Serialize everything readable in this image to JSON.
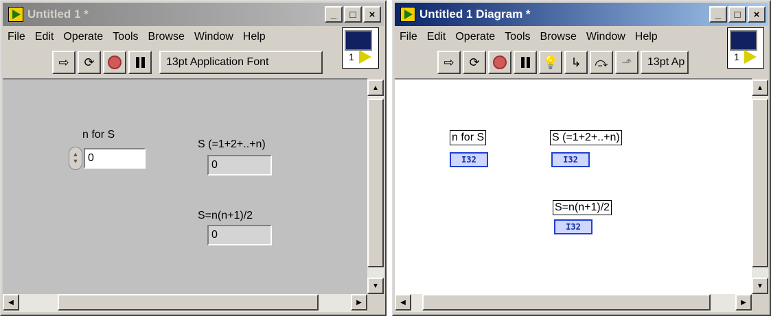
{
  "front_window": {
    "title": "Untitled 1 *",
    "title_buttons": {
      "minimize": "_",
      "maximize": "□",
      "close": "×"
    },
    "menu": [
      "File",
      "Edit",
      "Operate",
      "Tools",
      "Browse",
      "Window",
      "Help"
    ],
    "font_dropdown": "13pt Application Font",
    "vi_icon_number": "1",
    "controls": {
      "n_label": "n for S",
      "n_value": "0",
      "s_sum_label": "S (=1+2+..+n)",
      "s_sum_value": "0",
      "s_formula_label": "S=n(n+1)/2",
      "s_formula_value": "0"
    }
  },
  "diagram_window": {
    "title": "Untitled 1 Diagram *",
    "title_buttons": {
      "minimize": "_",
      "maximize": "□",
      "close": "×"
    },
    "menu": [
      "File",
      "Edit",
      "Operate",
      "Tools",
      "Browse",
      "Window",
      "Help"
    ],
    "font_dropdown": "13pt Ap",
    "vi_icon_number": "1",
    "nodes": {
      "n_label": "n for S",
      "n_type": "I32",
      "s_sum_label": "S (=1+2+..+n)",
      "s_sum_type": "I32",
      "s_formula_label": "S=n(n+1)/2",
      "s_formula_type": "I32"
    }
  },
  "colors": {
    "active_title": "#0a246a",
    "inactive_title": "#808080",
    "panel_bg": "#c0c0c0",
    "terminal_blue": "#2040d0"
  },
  "icons": [
    "run-arrow-icon",
    "run-continuous-icon",
    "abort-icon",
    "pause-icon",
    "highlight-bulb-icon",
    "step-into-icon",
    "step-over-icon",
    "step-out-icon"
  ]
}
